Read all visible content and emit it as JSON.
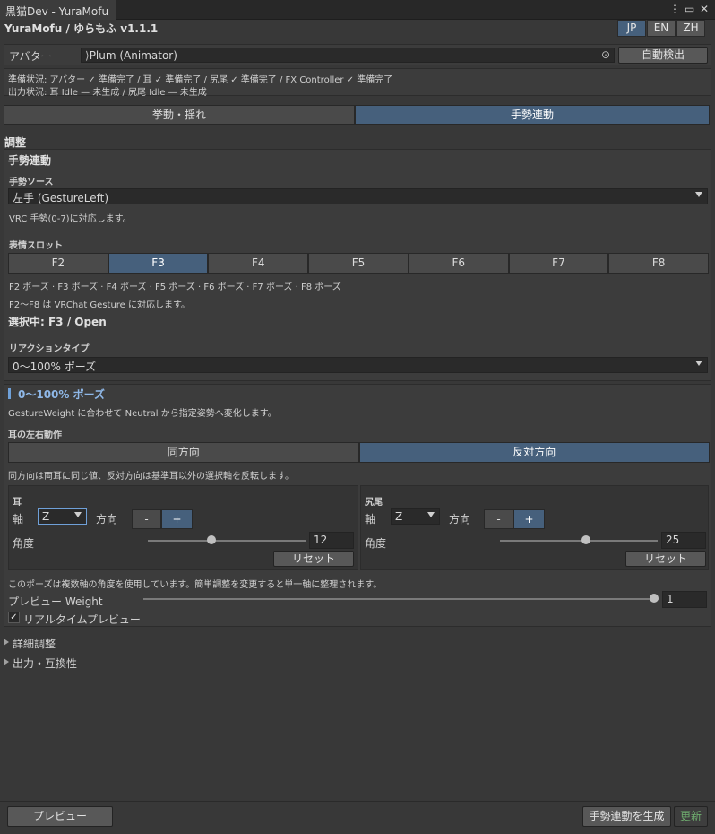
{
  "window": {
    "tab_title": "黒猫Dev - YuraMofu",
    "controls": [
      "⋮",
      "▭",
      "✕"
    ]
  },
  "header": {
    "title": "YuraMofu / ゆらもふ v1.1.1",
    "languages": [
      "JP",
      "EN",
      "ZH"
    ],
    "active_language": "JP"
  },
  "avatar": {
    "label": "アバター",
    "value": "Plum (Animator)",
    "auto_detect_label": "自動検出"
  },
  "status": {
    "line1": "準備状況: アバター ✓ 準備完了 / 耳 ✓ 準備完了 / 尻尾 ✓ 準備完了 / FX Controller ✓ 準備完了",
    "line2": "出力状況: 耳 Idle — 未生成 / 尻尾 Idle — 未生成"
  },
  "main_tabs": {
    "items": [
      "挙動・揺れ",
      "手勢連動"
    ],
    "active": "手勢連動"
  },
  "adjust": {
    "section_title": "調整",
    "subsection_title": "手勢連動",
    "gesture_source_label": "手勢ソース",
    "gesture_source_value": "左手 (GestureLeft)",
    "gesture_source_help": "VRC 手勢(0-7)に対応します。",
    "slot_label": "表情スロット",
    "slots": [
      "F2",
      "F3",
      "F4",
      "F5",
      "F6",
      "F7",
      "F8"
    ],
    "active_slot": "F3",
    "slots_summary": "F2 ポーズ · F3 ポーズ · F4 ポーズ · F5 ポーズ · F6 ポーズ · F7 ポーズ · F8 ポーズ",
    "slots_help": "F2〜F8 は VRChat Gesture に対応します。",
    "selected_text": "選択中: F3 / Open",
    "reaction_type_label": "リアクションタイプ",
    "reaction_type_value": "0〜100% ポーズ"
  },
  "pose": {
    "title": "0〜100% ポーズ",
    "description": "GestureWeight に合わせて Neutral から指定姿勢へ変化します。",
    "ear_lr_label": "耳の左右動作",
    "direction_options": [
      "同方向",
      "反対方向"
    ],
    "direction_active": "反対方向",
    "direction_help": "同方向は両耳に同じ値、反対方向は基準耳以外の選択軸を反転します。",
    "ear": {
      "title": "耳",
      "axis_label": "軸",
      "axis_value": "Z",
      "direction_label": "方向",
      "minus": "-",
      "plus": "+",
      "active_direction": "+",
      "angle_label": "角度",
      "angle_value": "12",
      "slider_fraction": 0.4,
      "reset_label": "リセット"
    },
    "tail": {
      "title": "尻尾",
      "axis_label": "軸",
      "axis_value": "Z",
      "direction_label": "方向",
      "minus": "-",
      "plus": "+",
      "active_direction": "+",
      "angle_label": "角度",
      "angle_value": "25",
      "slider_fraction": 0.55,
      "reset_label": "リセット"
    },
    "multi_axis_note": "このポーズは複数軸の角度を使用しています。簡単調整を変更すると単一軸に整理されます。",
    "preview_weight_label": "プレビュー Weight",
    "preview_weight_value": "1",
    "realtime_preview_label": "リアルタイムプレビュー",
    "realtime_preview_checked": true
  },
  "foldouts": {
    "advanced": "詳細調整",
    "output": "出力・互換性"
  },
  "footer": {
    "preview_label": "プレビュー",
    "generate_label": "手勢連動を生成",
    "update_label": "更新"
  }
}
